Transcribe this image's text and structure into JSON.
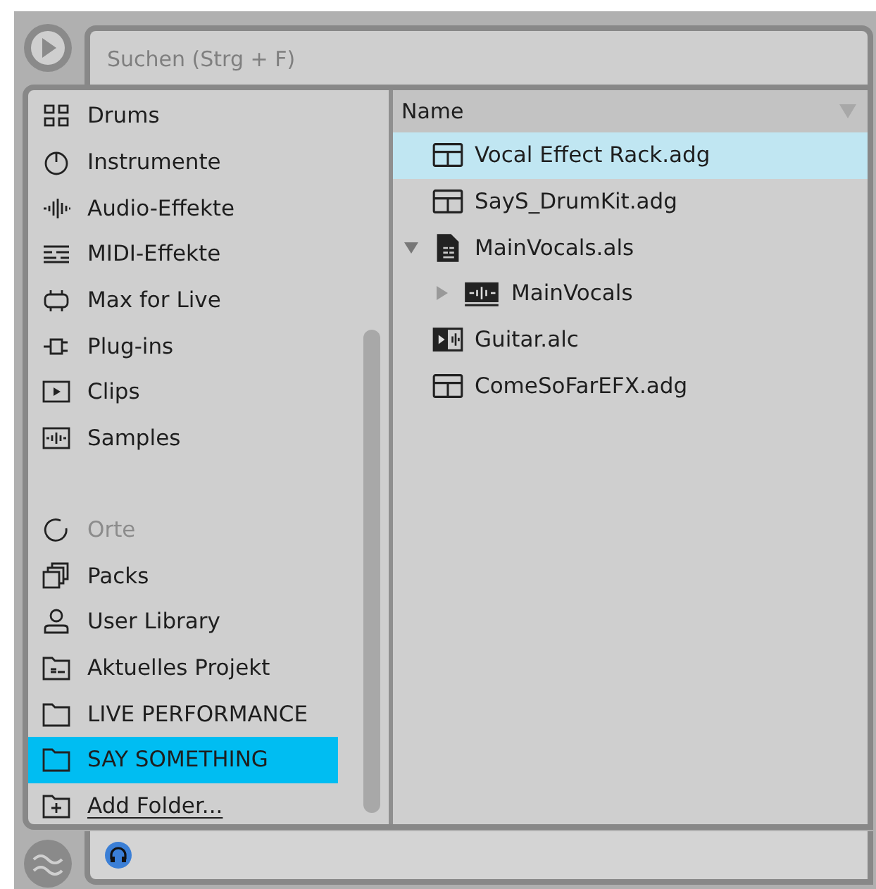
{
  "search": {
    "placeholder": "Suchen (Strg + F)"
  },
  "sidebar": {
    "categories": [
      {
        "label": "Drums",
        "selected": false
      },
      {
        "label": "Instrumente",
        "selected": false
      },
      {
        "label": "Audio-Effekte",
        "selected": false
      },
      {
        "label": "MIDI-Effekte",
        "selected": false
      },
      {
        "label": "Max for Live",
        "selected": false
      },
      {
        "label": "Plug-ins",
        "selected": false
      },
      {
        "label": "Clips",
        "selected": false
      },
      {
        "label": "Samples",
        "selected": false
      }
    ],
    "places_header": "Orte",
    "places": [
      {
        "label": "Packs",
        "selected": false
      },
      {
        "label": "User Library",
        "selected": false
      },
      {
        "label": "Aktuelles Projekt",
        "selected": false
      },
      {
        "label": "LIVE PERFORMANCE",
        "selected": false
      },
      {
        "label": "SAY SOMETHING",
        "selected": true
      }
    ],
    "add_folder": "Add Folder..."
  },
  "files": {
    "column": "Name",
    "rows": [
      {
        "name": "Vocal Effect Rack.adg",
        "kind": "rack",
        "selected": true
      },
      {
        "name": "SayS_DrumKit.adg",
        "kind": "rack",
        "selected": false
      },
      {
        "name": "MainVocals.als",
        "kind": "set",
        "selected": false,
        "expanded": true,
        "children": [
          {
            "name": "MainVocals",
            "kind": "track",
            "selected": false,
            "expanded": false
          }
        ]
      },
      {
        "name": "Guitar.alc",
        "kind": "clip",
        "selected": false
      },
      {
        "name": "ComeSoFarEFX.adg",
        "kind": "rack",
        "selected": false
      }
    ]
  }
}
